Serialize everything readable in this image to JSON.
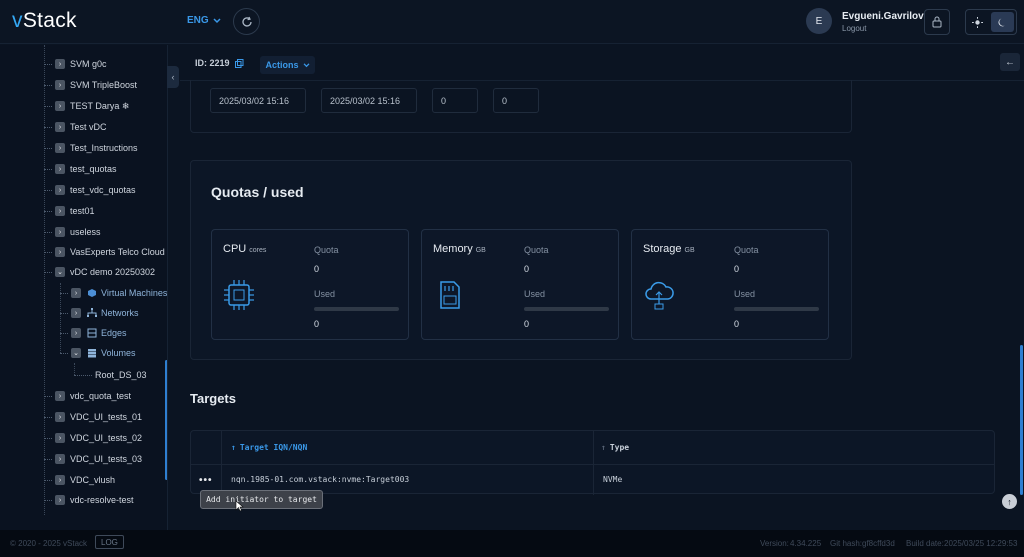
{
  "header": {
    "logo_accent": "v",
    "logo_text": "Stack",
    "language": "ENG",
    "user_initial": "E",
    "user_name": "Evgueni.Gavrilov",
    "logout_label": "Logout",
    "accent_color": "#35a9f5"
  },
  "sidebar": {
    "items": [
      {
        "label": "SVM g0c"
      },
      {
        "label": "SVM TripleBoost"
      },
      {
        "label": "TEST Darya ❄"
      },
      {
        "label": "Test vDC"
      },
      {
        "label": "Test_Instructions"
      },
      {
        "label": "test_quotas"
      },
      {
        "label": "test_vdc_quotas"
      },
      {
        "label": "test01"
      },
      {
        "label": "useless"
      },
      {
        "label": "VasExperts Telco Cloud"
      },
      {
        "label": "vDC demo 20250302"
      },
      {
        "label": "vdc_quota_test"
      },
      {
        "label": "VDC_UI_tests_01"
      },
      {
        "label": "VDC_UI_tests_02"
      },
      {
        "label": "VDC_UI_tests_03"
      },
      {
        "label": "VDC_vlush"
      },
      {
        "label": "vdc-resolve-test"
      }
    ],
    "children": [
      {
        "label": "Virtual Machines",
        "icon": "cube-icon"
      },
      {
        "label": "Networks",
        "icon": "network-icon"
      },
      {
        "label": "Edges",
        "icon": "edge-icon"
      },
      {
        "label": "Volumes",
        "icon": "database-icon"
      }
    ],
    "grandchild": {
      "label": "Root_DS_03"
    }
  },
  "toolbar": {
    "id_label": "ID: 2219",
    "actions_label": "Actions"
  },
  "top_card": {
    "created": "2025/03/02 15:16",
    "updated": "2025/03/02 15:16",
    "val1": "0",
    "val2": "0"
  },
  "quotas": {
    "title": "Quotas / used",
    "quota_label": "Quota",
    "used_label": "Used",
    "cards": [
      {
        "name": "CPU",
        "unit": "cores",
        "quota": "0",
        "used": "0",
        "usage": 0
      },
      {
        "name": "Memory",
        "unit": "GB",
        "quota": "0",
        "used": "0",
        "usage": 0
      },
      {
        "name": "Storage",
        "unit": "GB",
        "quota": "0",
        "used": "0",
        "usage": 0
      }
    ]
  },
  "targets": {
    "title": "Targets",
    "columns": [
      "Target IQN/NQN",
      "Type"
    ],
    "rows": [
      {
        "iqn": "nqn.1985-01.com.vstack:nvme:Target003",
        "type": "NVMe"
      }
    ],
    "tooltip": "Add initiator to target"
  },
  "footer": {
    "copyright": "© 2020 - 2025 vStack",
    "log_label": "LOG",
    "version_label": "Version:",
    "version": "4.34.225",
    "git_label": "Git hash:",
    "git_hash": "gf8cffd3d",
    "build_label": "Build date:",
    "build_date": "2025/03/25 12:29:53"
  }
}
